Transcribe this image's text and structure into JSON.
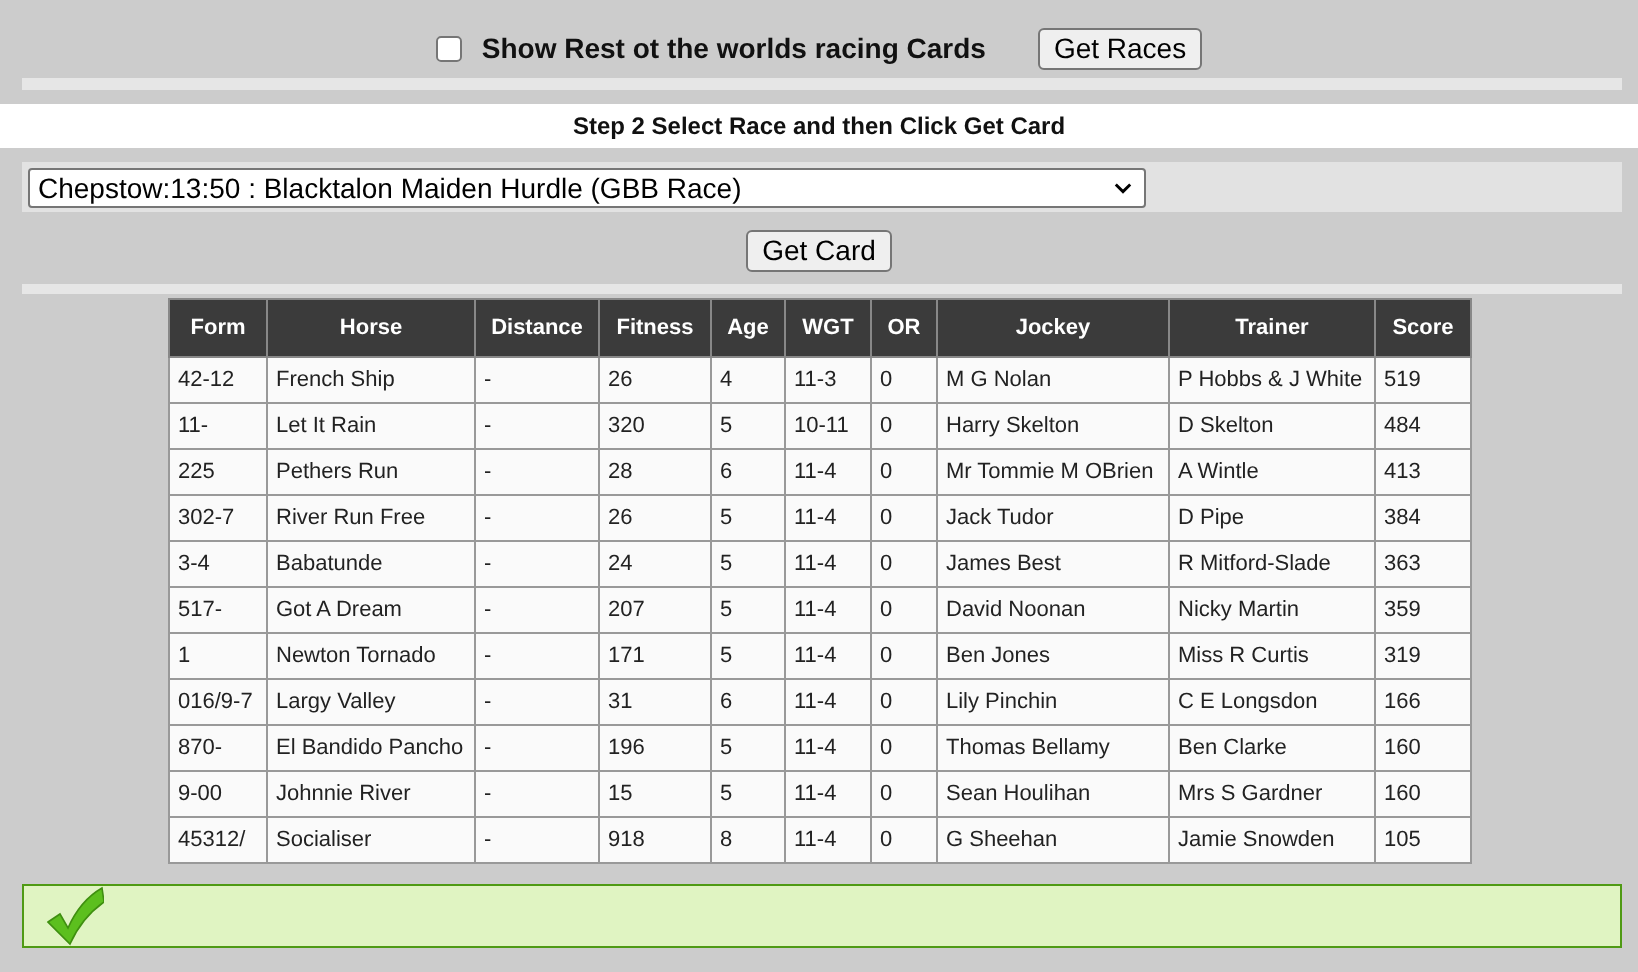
{
  "top_bar": {
    "checkbox": {
      "label": "Show Rest ot the worlds racing Cards",
      "checked": false
    },
    "button": "Get Races"
  },
  "step_heading": "Step 2 Select Race and then Click Get Card",
  "race_select": {
    "value": "Chepstow:13:50 : Blacktalon Maiden Hurdle (GBB Race)"
  },
  "get_card_button": "Get Card",
  "table": {
    "columns": [
      "Form",
      "Horse",
      "Distance",
      "Fitness",
      "Age",
      "WGT",
      "OR",
      "Jockey",
      "Trainer",
      "Score"
    ],
    "rows": [
      [
        "42-12",
        "French Ship",
        "-",
        "26",
        "4",
        "11-3",
        "0",
        "M G Nolan",
        "P Hobbs & J White",
        "519"
      ],
      [
        "11-",
        "Let It Rain",
        "-",
        "320",
        "5",
        "10-11",
        "0",
        "Harry Skelton",
        "D Skelton",
        "484"
      ],
      [
        "225",
        "Pethers Run",
        "-",
        "28",
        "6",
        "11-4",
        "0",
        "Mr Tommie M OBrien",
        "A Wintle",
        "413"
      ],
      [
        "302-7",
        "River Run Free",
        "-",
        "26",
        "5",
        "11-4",
        "0",
        "Jack Tudor",
        "D Pipe",
        "384"
      ],
      [
        "3-4",
        "Babatunde",
        "-",
        "24",
        "5",
        "11-4",
        "0",
        "James Best",
        "R Mitford-Slade",
        "363"
      ],
      [
        "517-",
        "Got A Dream",
        "-",
        "207",
        "5",
        "11-4",
        "0",
        "David Noonan",
        "Nicky Martin",
        "359"
      ],
      [
        "1",
        "Newton Tornado",
        "-",
        "171",
        "5",
        "11-4",
        "0",
        "Ben Jones",
        "Miss R Curtis",
        "319"
      ],
      [
        "016/9-7",
        "Largy Valley",
        "-",
        "31",
        "6",
        "11-4",
        "0",
        "Lily Pinchin",
        "C E Longsdon",
        "166"
      ],
      [
        "870-",
        "El Bandido Pancho",
        "-",
        "196",
        "5",
        "11-4",
        "0",
        "Thomas Bellamy",
        "Ben Clarke",
        "160"
      ],
      [
        "9-00",
        "Johnnie River",
        "-",
        "15",
        "5",
        "11-4",
        "0",
        "Sean Houlihan",
        "Mrs S Gardner",
        "160"
      ],
      [
        "45312/",
        "Socialiser",
        "-",
        "918",
        "8",
        "11-4",
        "0",
        "G Sheehan",
        "Jamie Snowden",
        "105"
      ]
    ]
  },
  "status": {
    "kind": "success"
  }
}
